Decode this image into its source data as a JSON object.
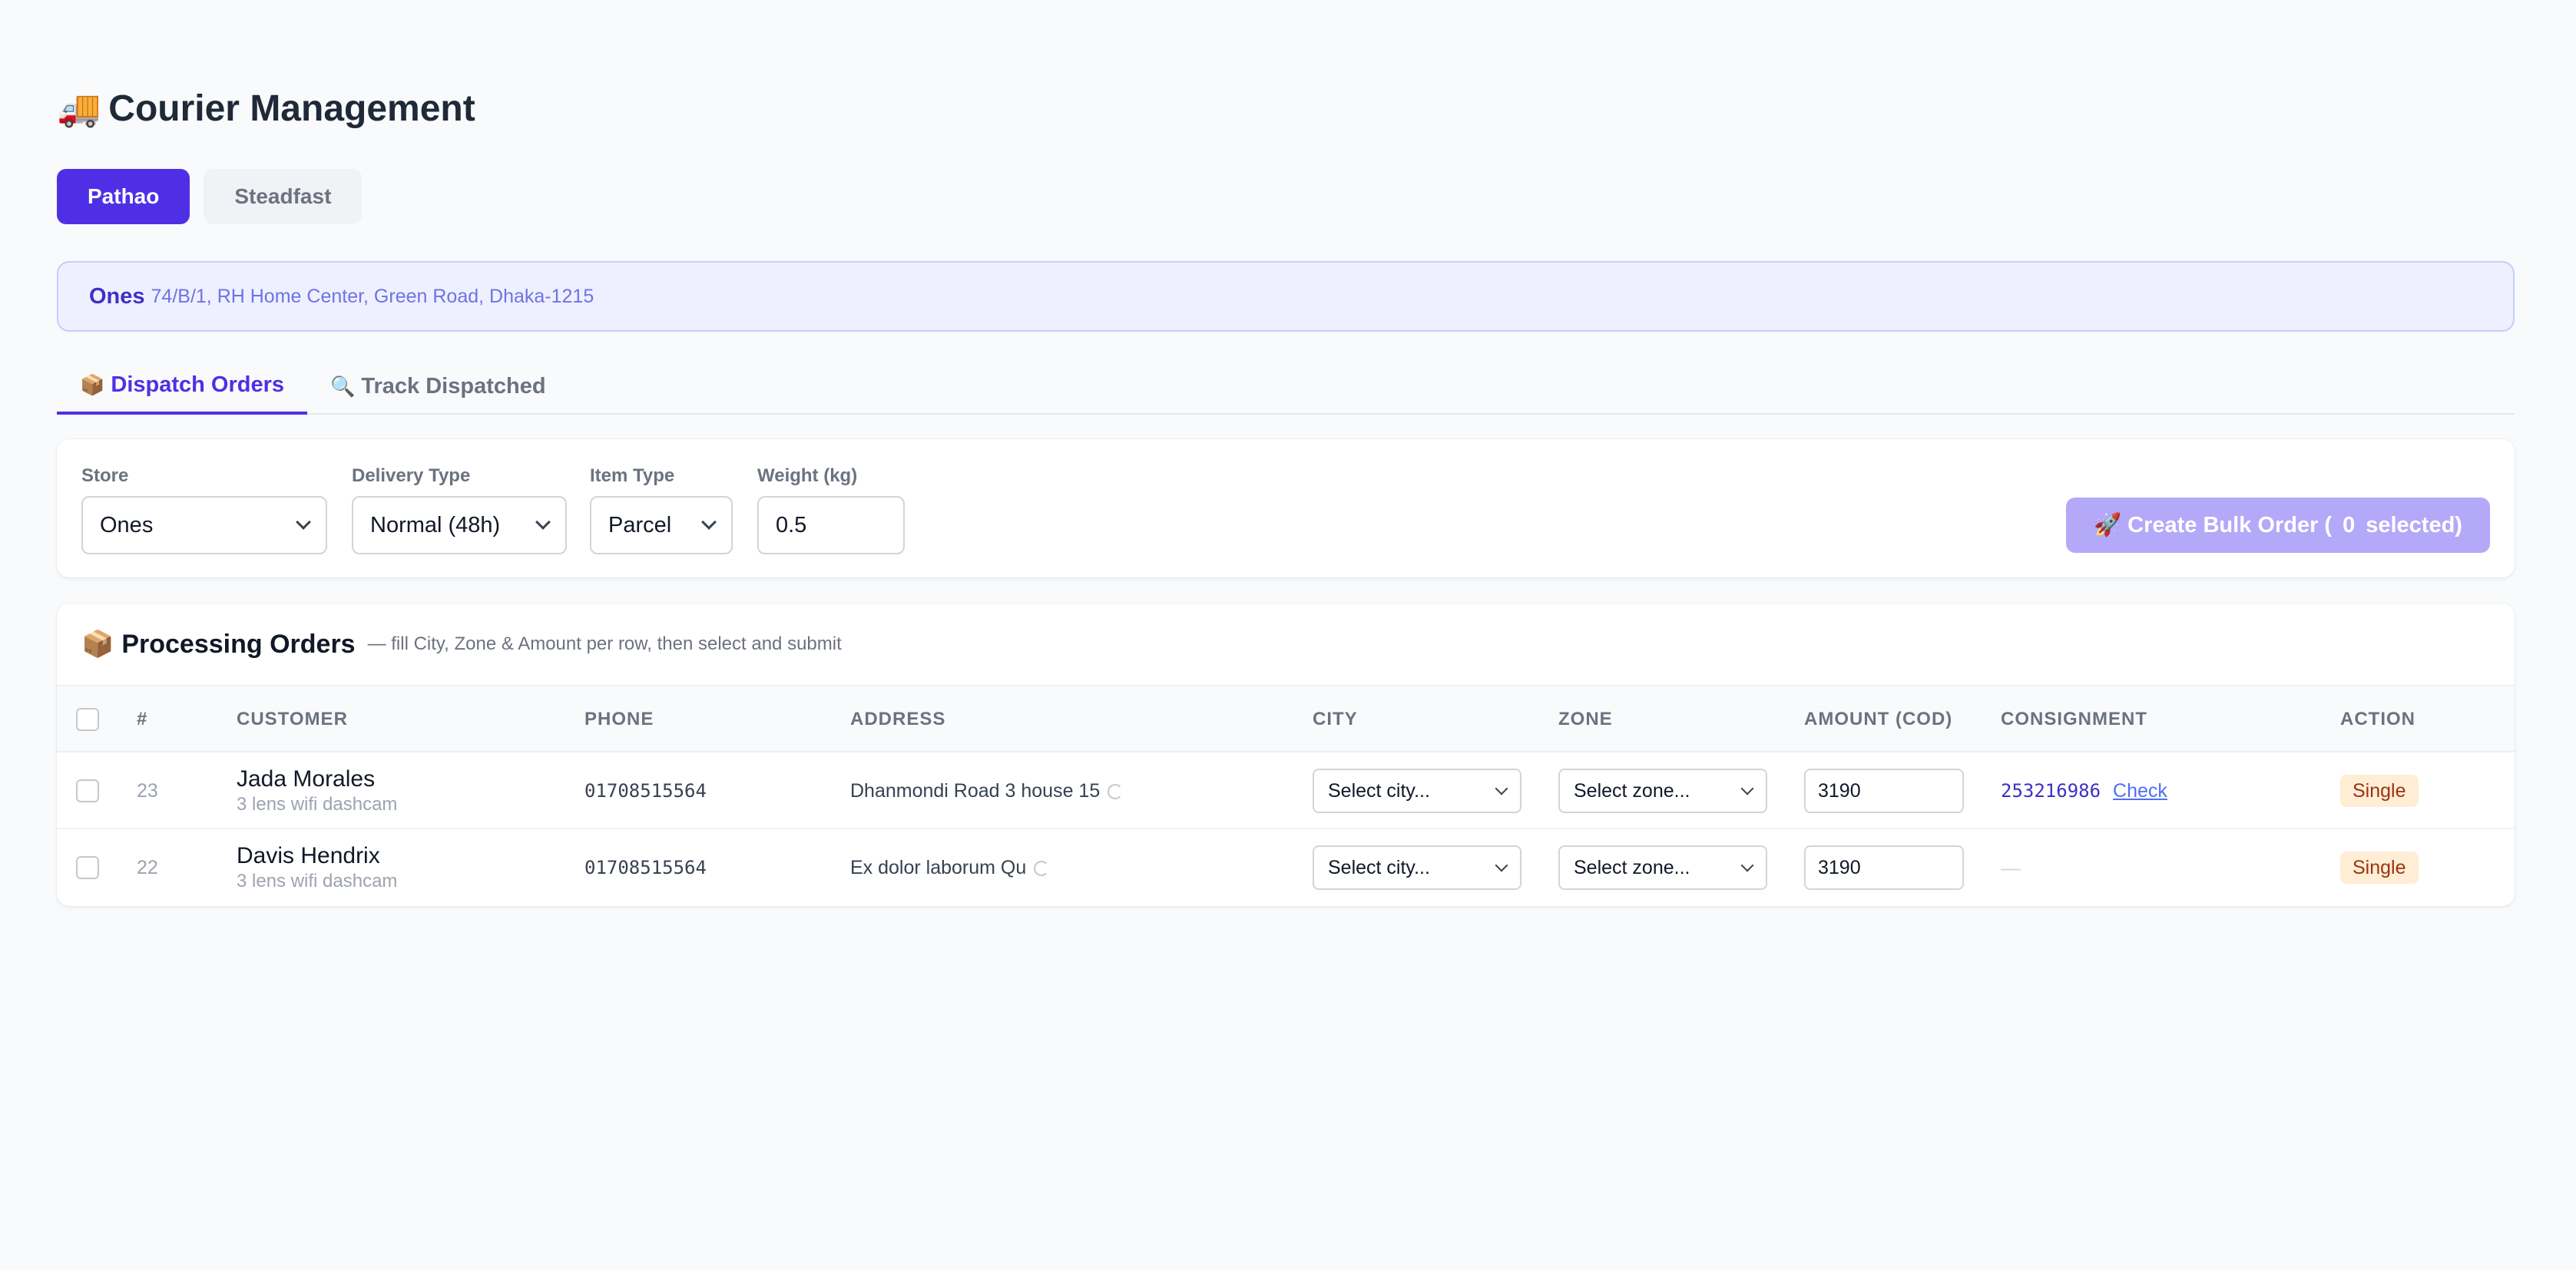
{
  "header": {
    "icon": "truck-emoji",
    "emoji": "🚚",
    "title": "Courier Management"
  },
  "courier_tabs": [
    {
      "label": "Pathao",
      "active": true
    },
    {
      "label": "Steadfast",
      "active": false
    }
  ],
  "store_banner": {
    "name": "Ones",
    "address": "74/B/1, RH Home Center, Green Road, Dhaka-1215"
  },
  "view_tabs": [
    {
      "icon": "📦",
      "label": "Dispatch Orders",
      "active": true
    },
    {
      "icon": "🔍",
      "label": "Track Dispatched",
      "active": false
    }
  ],
  "filters": {
    "store": {
      "label": "Store",
      "value": "Ones"
    },
    "delivery_type": {
      "label": "Delivery Type",
      "value": "Normal (48h)"
    },
    "item_type": {
      "label": "Item Type",
      "value": "Parcel"
    },
    "weight": {
      "label": "Weight (kg)",
      "value": "0.5"
    },
    "bulk_button": {
      "icon": "🚀",
      "prefix": "Create Bulk Order (",
      "count": "0",
      "suffix": "selected)"
    }
  },
  "orders": {
    "icon": "📦",
    "title": "Processing Orders",
    "subtitle": "— fill City, Zone & Amount per row, then select and submit",
    "columns": [
      "#",
      "CUSTOMER",
      "PHONE",
      "ADDRESS",
      "CITY",
      "ZONE",
      "AMOUNT (COD)",
      "CONSIGNMENT",
      "ACTION"
    ],
    "rows": [
      {
        "id": "23",
        "customer": "Jada Morales",
        "product": "3 lens wifi dashcam",
        "phone": "01708515564",
        "address": "Dhanmondi Road 3 house 15",
        "city_placeholder": "Select city...",
        "zone_placeholder": "Select zone...",
        "amount": "3190",
        "consignment": "253216986",
        "check_label": "Check",
        "action": "Single"
      },
      {
        "id": "22",
        "customer": "Davis Hendrix",
        "product": "3 lens wifi dashcam",
        "phone": "01708515564",
        "address": "Ex dolor laborum Qu",
        "city_placeholder": "Select city...",
        "zone_placeholder": "Select zone...",
        "amount": "3190",
        "consignment": "—",
        "check_label": "",
        "action": "Single"
      }
    ]
  },
  "colors": {
    "accent": "#4f2fe6",
    "accent_light": "#b4a8f9",
    "banner_bg": "#eef0ff",
    "badge_bg": "#ffedd5"
  }
}
